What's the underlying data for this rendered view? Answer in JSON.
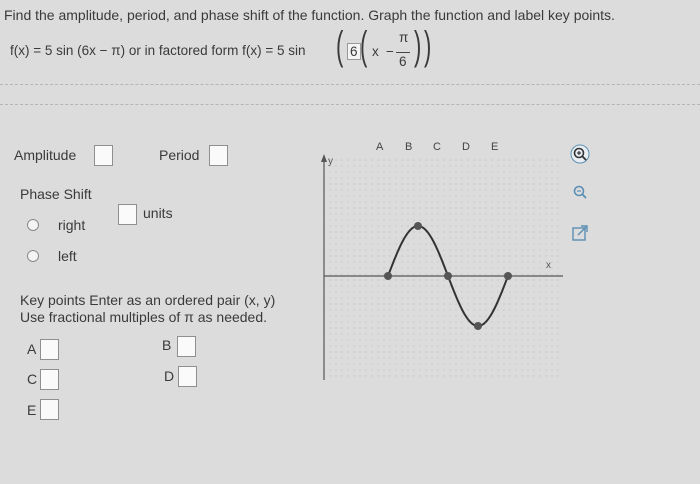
{
  "question": {
    "prompt": "Find the amplitude, period, and phase shift of the function. Graph the function and label key points.",
    "function_line_prefix": "f(x) = 5 sin (6x − π) or in factored form f(x) = 5 sin",
    "factored_inner": {
      "coefficient": "6",
      "var": "x",
      "minus": "−",
      "frac_num": "π",
      "frac_den": "6"
    }
  },
  "fields": {
    "amplitude_label": "Amplitude",
    "amplitude_value": "",
    "period_label": "Period",
    "period_value": "",
    "phase_shift_label": "Phase Shift",
    "phase_value": "",
    "units_label": "units",
    "options": [
      {
        "label": "right",
        "selected": false
      },
      {
        "label": "left",
        "selected": false
      }
    ]
  },
  "key_points": {
    "instruction_line1": "Key points   Enter as an ordered pair (x, y)",
    "instruction_line2": "Use fractional multiples of π as needed.",
    "points": [
      {
        "label": "A",
        "value": ""
      },
      {
        "label": "B",
        "value": ""
      },
      {
        "label": "C",
        "value": ""
      },
      {
        "label": "D",
        "value": ""
      },
      {
        "label": "E",
        "value": ""
      }
    ]
  },
  "graph": {
    "y_axis_label": "y",
    "x_axis_label": "x",
    "point_labels": [
      "A",
      "B",
      "C",
      "D",
      "E"
    ],
    "curve_color": "#333333",
    "point_color": "#555555"
  },
  "tools": {
    "icons": [
      "zoom-in-icon",
      "zoom-out-icon",
      "external-link-icon"
    ],
    "accent": "#5b8fb3"
  }
}
